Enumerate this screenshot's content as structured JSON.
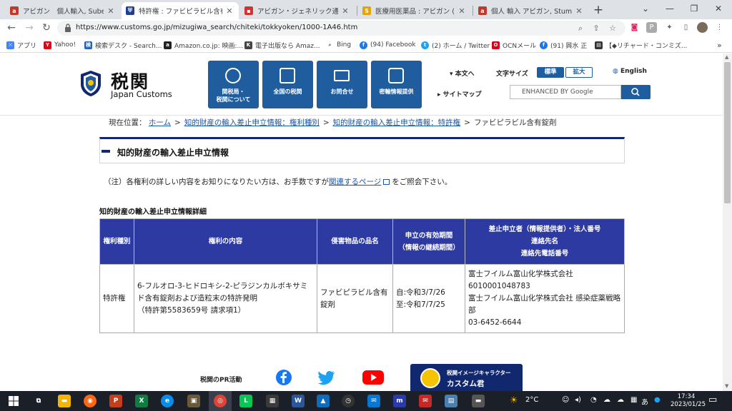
{
  "browser": {
    "tabs": [
      {
        "title": "アビガン　個人輸入, Subetene",
        "favicon_color": "#c0392b",
        "active": false
      },
      {
        "title": "特許権 : ファビピラビル含有錠剤",
        "favicon_color": "#1f3f8c",
        "active": true
      },
      {
        "title": "アビガン・ジェネリック通販｜ファ",
        "favicon_color": "#d63031",
        "active": false
      },
      {
        "title": "医療用医薬品 : アビガン (アビガ",
        "favicon_color": "#e6a400",
        "active": false
      },
      {
        "title": "個人 輸入 アビガン, StumbleUp",
        "favicon_color": "#c0392b",
        "active": false
      }
    ],
    "new_tab_symbol": "+",
    "window_controls": {
      "dropdown": "⌄",
      "minimize": "—",
      "restore": "❐",
      "close": "✕"
    },
    "nav": {
      "back": "←",
      "forward": "→",
      "reload": "↻"
    },
    "url": "https://www.customs.go.jp/mizugiwa_search/chiteki/tokkyoken/1000-1A46.htm",
    "bookmarks": [
      {
        "label": "アプリ",
        "color": "#4285f4"
      },
      {
        "label": "Yahoo!",
        "color": "#e60012"
      },
      {
        "label": "検索デスク - Search...",
        "color": "#2c62b5"
      },
      {
        "label": "Amazon.co.jp: 映画:...",
        "color": "#222222"
      },
      {
        "label": "電子出版なら Amaz...",
        "color": "#444444"
      },
      {
        "label": "Bing",
        "color": "#5f6368"
      },
      {
        "label": "(94) Facebook",
        "color": "#1877f2"
      },
      {
        "label": "(2) ホーム / Twitter",
        "color": "#1da1f2"
      },
      {
        "label": "OCNメール",
        "color": "#d6001c"
      },
      {
        "label": "(91) 興水 正",
        "color": "#1877f2"
      },
      {
        "label": "【◆リチャード・コンミズ...",
        "color": "#333333"
      }
    ],
    "more_bookmarks": "»"
  },
  "site_header": {
    "logo_ja": "税関",
    "logo_en": "Japan Customs",
    "global_nav": [
      {
        "label": "関税局・\n税関について"
      },
      {
        "label": "全国の税関"
      },
      {
        "label": "お問合せ"
      },
      {
        "label": "密輸情報提供"
      }
    ],
    "main_text_link": "本文へ",
    "font_size_label": "文字サイズ",
    "font_size_standard": "標準",
    "font_size_large": "拡大",
    "english_link": "English",
    "sitemap_link": "サイトマップ",
    "search_placeholder": "ENHANCED BY Google"
  },
  "breadcrumb": {
    "prefix": "現在位置：",
    "items": [
      "ホーム",
      "知的財産の輸入差止申立情報：権利種別",
      "知的財産の輸入差止申立情報：特許権"
    ],
    "current": "ファビピラビル含有錠剤",
    "separator": ">"
  },
  "section_title": "知的財産の輸入差止申立情報",
  "note": {
    "before": "（注）各権利の詳しい内容をお知りになりたい方は、お手数ですが",
    "link": "関連するページ",
    "after": "をご照会下さい。"
  },
  "table": {
    "caption": "知的財産の輸入差止申立情報詳細",
    "headers": [
      "権利種別",
      "権利の内容",
      "侵害物品の品名",
      "申立の有効期間\n（情報の継続期間）",
      "差止申立者（情報提供者）・法人番号\n連絡先名\n連絡先電話番号"
    ],
    "row": {
      "right_type": "特許権",
      "right_content_1": "6-フルオロ-3-ヒドロキシ-2-ピラジンカルボキサミド含有錠剤および造粒末の特許発明",
      "right_content_2": "（特許第5583659号 請求項1）",
      "item_name": "ファビピラビル含有錠剤",
      "period_from": "自:令和3/7/26",
      "period_to": "至:令和7/7/25",
      "applicant": "富士フイルム富山化学株式会社",
      "corp_number": "6010001048783",
      "contact_name": "富士フイルム富山化学株式会社 感染症薬戦略部",
      "phone": "03-6452-6644"
    }
  },
  "footer": {
    "pr_label": "税関のPR活動",
    "mascot_caption": "税関イメージキャラクター",
    "mascot_name": "カスタム君"
  },
  "taskbar": {
    "weather": "2°C",
    "ime": "あ",
    "time": "17:34",
    "date": "2023/01/25"
  },
  "colors": {
    "customs_blue": "#1f5d9e",
    "table_header": "#2d3aa2",
    "title_navy": "#12286e",
    "link_blue": "#1a55a5"
  }
}
